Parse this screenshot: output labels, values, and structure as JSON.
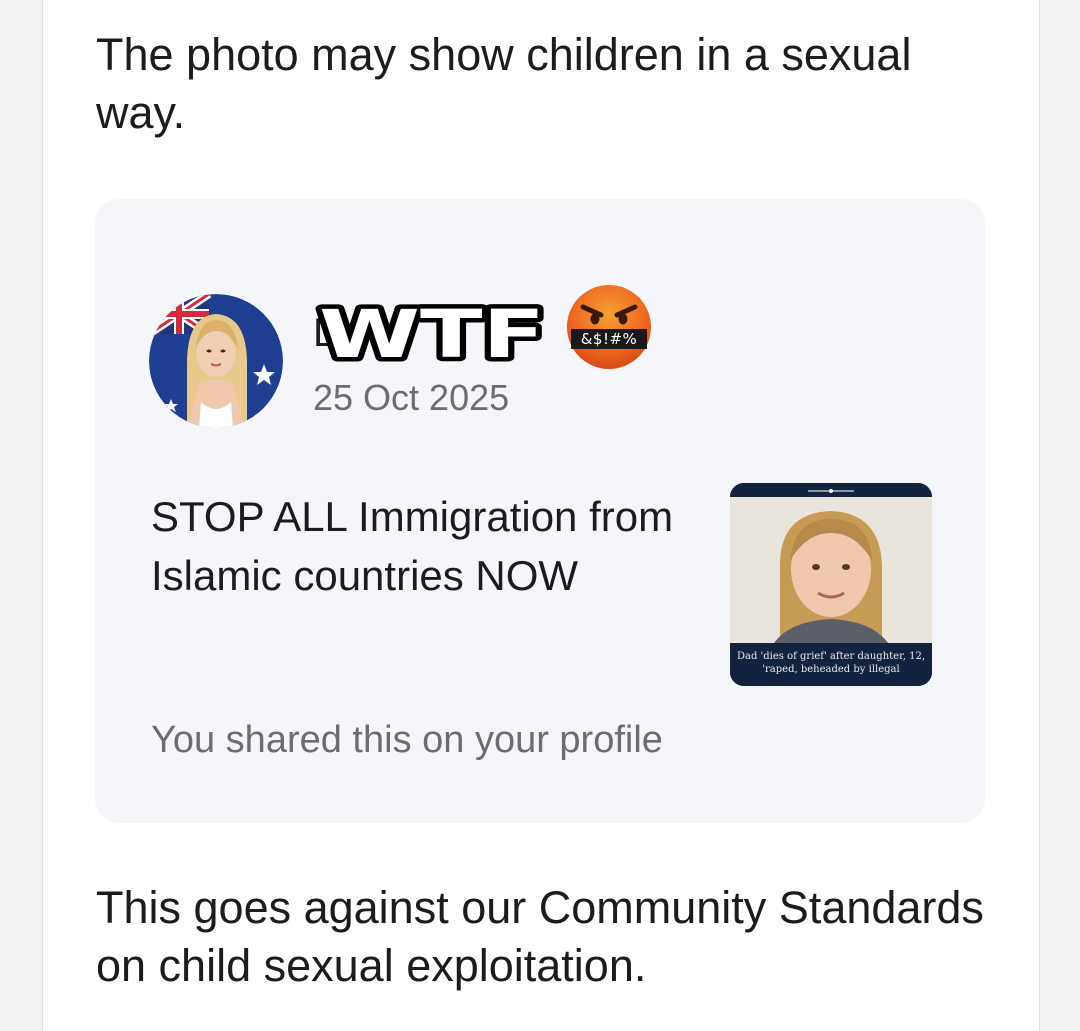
{
  "notice": {
    "intro": "The photo may show children in a sexual way.",
    "outro": "This goes against our Community Standards on child sexual exploitation."
  },
  "post": {
    "author_name": "L          a        n",
    "date": "25 Oct 2025",
    "text": "STOP ALL Immigration from Islamic countries NOW",
    "shared_note": "You shared this on your profile",
    "thumbnail_caption": "Dad 'dies of grief' after daughter, 12, 'raped, beheaded by illegal"
  },
  "overlay": {
    "sticker_text": "WTF",
    "emoji_symbols": "&$!#%",
    "emoji_icon": "face-with-symbols-on-mouth-icon"
  },
  "colors": {
    "text_primary": "#1c1c1e",
    "text_secondary": "#6b6d72",
    "card_background": "#f5f6fa",
    "thumbnail_frame": "#14233d",
    "emoji_orange": "#e8591a"
  }
}
